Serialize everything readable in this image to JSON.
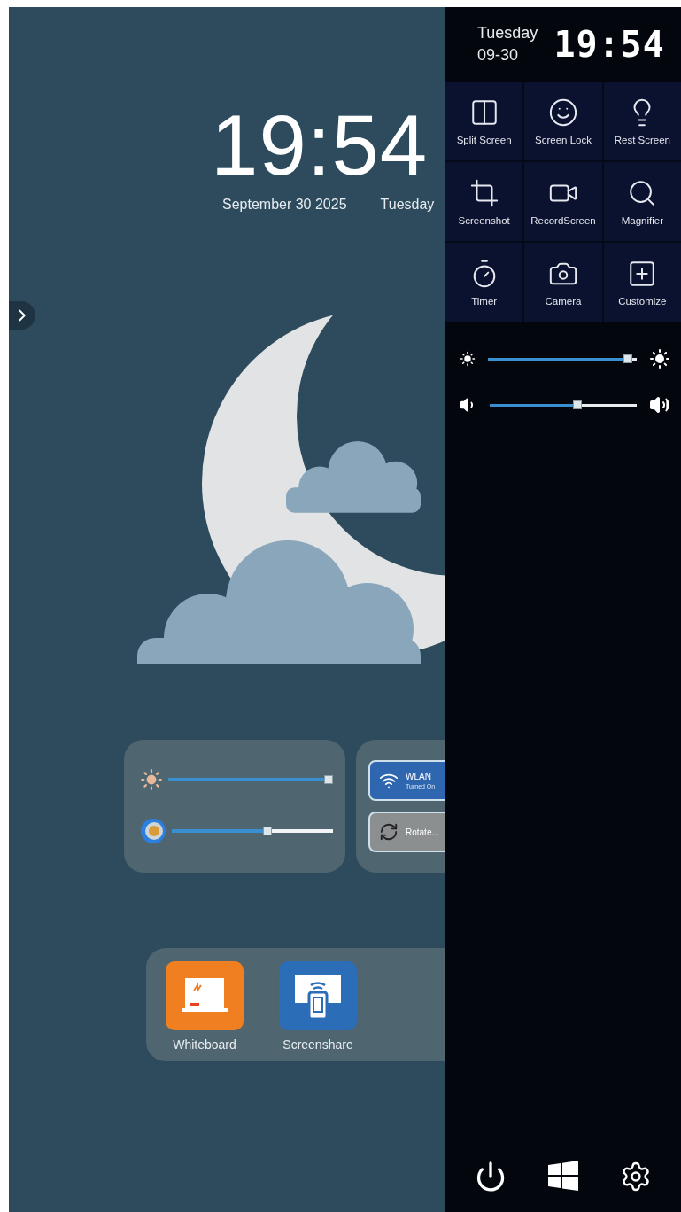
{
  "desktop": {
    "clock": {
      "time": "19:54",
      "date": "September 30 2025",
      "weekday": "Tuesday"
    },
    "widget_sliders": [
      {
        "kind": "brightness",
        "level": 1.0
      },
      {
        "kind": "volume",
        "level": 0.6
      }
    ],
    "toggles": [
      {
        "kind": "wlan",
        "label": "WLAN",
        "status": "Turned On",
        "on": true
      },
      {
        "kind": "rotate",
        "label": "Rotate...",
        "on": false
      }
    ],
    "dock": [
      {
        "kind": "whiteboard",
        "label": "Whiteboard"
      },
      {
        "kind": "screenshare",
        "label": "Screenshare"
      }
    ]
  },
  "panel": {
    "weekday": "Tuesday",
    "date": "09-30",
    "time": "19:54",
    "tiles": [
      {
        "kind": "split",
        "label": "Split Screen"
      },
      {
        "kind": "lock",
        "label": "Screen Lock"
      },
      {
        "kind": "rest",
        "label": "Rest Screen"
      },
      {
        "kind": "screenshot",
        "label": "Screenshot"
      },
      {
        "kind": "record",
        "label": "RecordScreen"
      },
      {
        "kind": "magnifier",
        "label": "Magnifier"
      },
      {
        "kind": "timer",
        "label": "Timer"
      },
      {
        "kind": "camera",
        "label": "Camera"
      },
      {
        "kind": "customize",
        "label": "Customize"
      }
    ],
    "sliders": [
      {
        "kind": "brightness",
        "level": 0.97
      },
      {
        "kind": "volume",
        "level": 0.6
      }
    ],
    "buttons": [
      {
        "kind": "power"
      },
      {
        "kind": "windows"
      },
      {
        "kind": "settings"
      }
    ]
  }
}
